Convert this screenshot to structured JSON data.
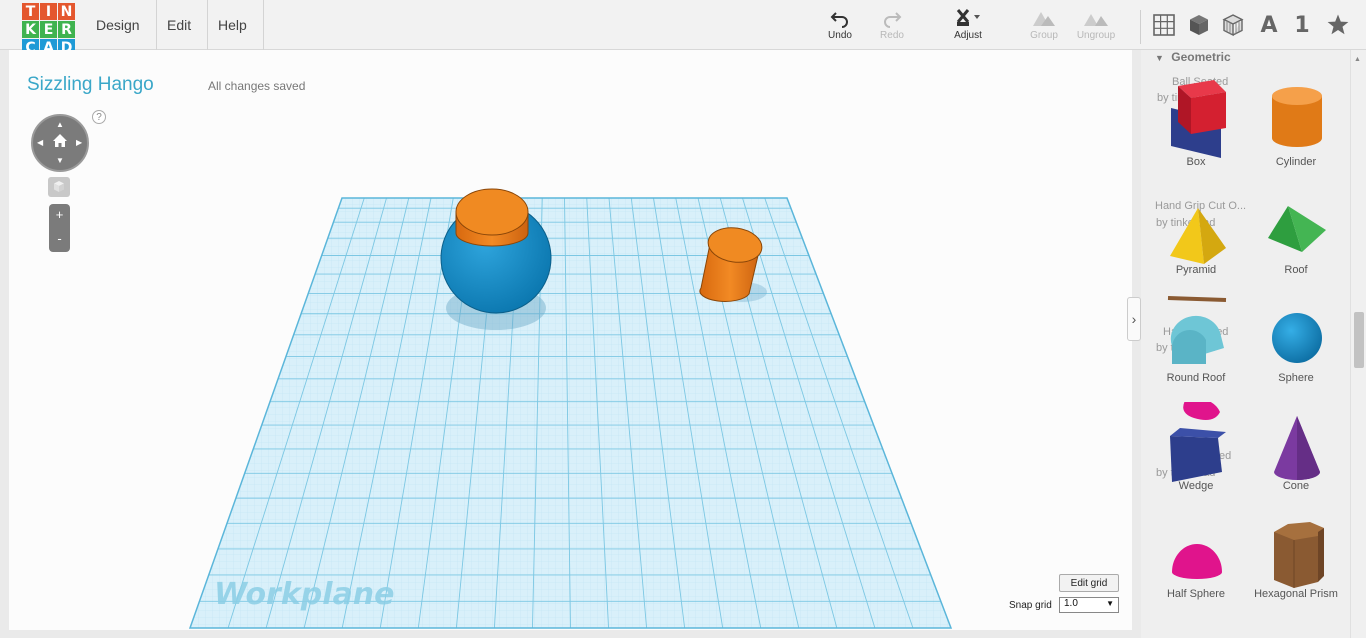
{
  "app": {
    "logo_letters": [
      "T",
      "I",
      "N",
      "K",
      "E",
      "R",
      "C",
      "A",
      "D"
    ],
    "logo_colors": [
      "#e4572e",
      "#e4572e",
      "#e4572e",
      "#3fb34f",
      "#3fb34f",
      "#3fb34f",
      "#1e9ad6",
      "#1e9ad6",
      "#1e9ad6"
    ]
  },
  "menu": {
    "design": "Design",
    "edit": "Edit",
    "help": "Help"
  },
  "toolbar": {
    "undo": "Undo",
    "redo": "Redo",
    "adjust": "Adjust",
    "group": "Group",
    "ungroup": "Ungroup",
    "text_tool": "A",
    "number_tool": "1"
  },
  "project": {
    "title": "Sizzling Hango",
    "save_status": "All changes saved"
  },
  "view_controls": {
    "help": "?",
    "zoom_in": "+",
    "zoom_out": "-"
  },
  "workplane": {
    "label": "Workplane",
    "edit_grid": "Edit grid",
    "snap_label": "Snap grid",
    "snap_value": "1.0"
  },
  "panel": {
    "heading": "Geometric",
    "ghost_texts": [
      "Ball Seated",
      "by tinkercad",
      "Hand Grip Cut O...",
      "by tinkercad",
      "Hand Grip ed",
      "by tinkercad",
      "by tinkercad",
      "ed"
    ],
    "shapes": [
      {
        "label": "Box",
        "icon": "box-icon",
        "color": "#d42030"
      },
      {
        "label": "Cylinder",
        "icon": "cylinder-icon",
        "color": "#e8811a"
      },
      {
        "label": "Pyramid",
        "icon": "pyramid-icon",
        "color": "#f2c81a"
      },
      {
        "label": "Roof",
        "icon": "roof-icon",
        "color": "#2ea043"
      },
      {
        "label": "Round Roof",
        "icon": "round-roof-icon",
        "color": "#6ec6d6"
      },
      {
        "label": "Sphere",
        "icon": "sphere-icon",
        "color": "#1a8fcf"
      },
      {
        "label": "Wedge",
        "icon": "wedge-icon",
        "color": "#2d3e8c"
      },
      {
        "label": "Cone",
        "icon": "cone-icon",
        "color": "#7b3aa0"
      },
      {
        "label": "Half Sphere",
        "icon": "half-sphere-icon",
        "color": "#e0148c"
      },
      {
        "label": "Hexagonal Prism",
        "icon": "hexagonal-prism-icon",
        "color": "#8a5a32"
      }
    ]
  },
  "colors": {
    "accent": "#3aa7c8",
    "grid": "#9ed6ec",
    "grid_border": "#6cc0e0"
  }
}
